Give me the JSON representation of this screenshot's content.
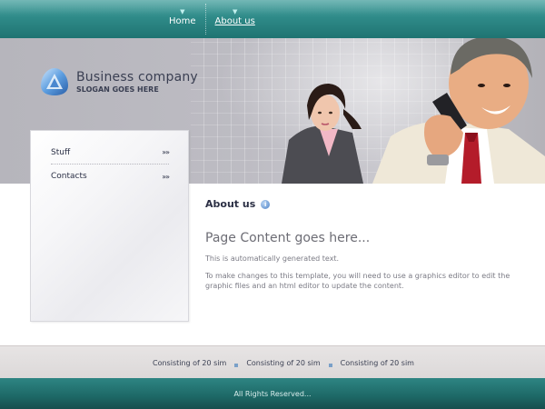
{
  "nav": {
    "items": [
      {
        "label": "Home",
        "active": false
      },
      {
        "label": "About us",
        "active": true
      }
    ]
  },
  "logo": {
    "name": "Business company",
    "slogan": "SLOGAN GOES HERE"
  },
  "sidebar": {
    "items": [
      {
        "label": "Stuff",
        "chevron": "»»"
      },
      {
        "label": "Contacts",
        "chevron": "»»"
      }
    ]
  },
  "content": {
    "section_title": "About us",
    "heading": "Page Content goes here...",
    "paragraphs": [
      "This is automatically generated text.",
      "To make changes to this template, you will need to use a graphics editor to edit the graphic files and an html editor to update the content."
    ]
  },
  "footer_links": [
    "Consisting of 20 sim",
    "Consisting of 20 sim",
    "Consisting of 20 sim"
  ],
  "copyright": "All Rights Reserved...",
  "colors": {
    "teal": "#2f8b89",
    "header_gray": "#bdbcc3",
    "text_dark": "#2b2f44"
  }
}
